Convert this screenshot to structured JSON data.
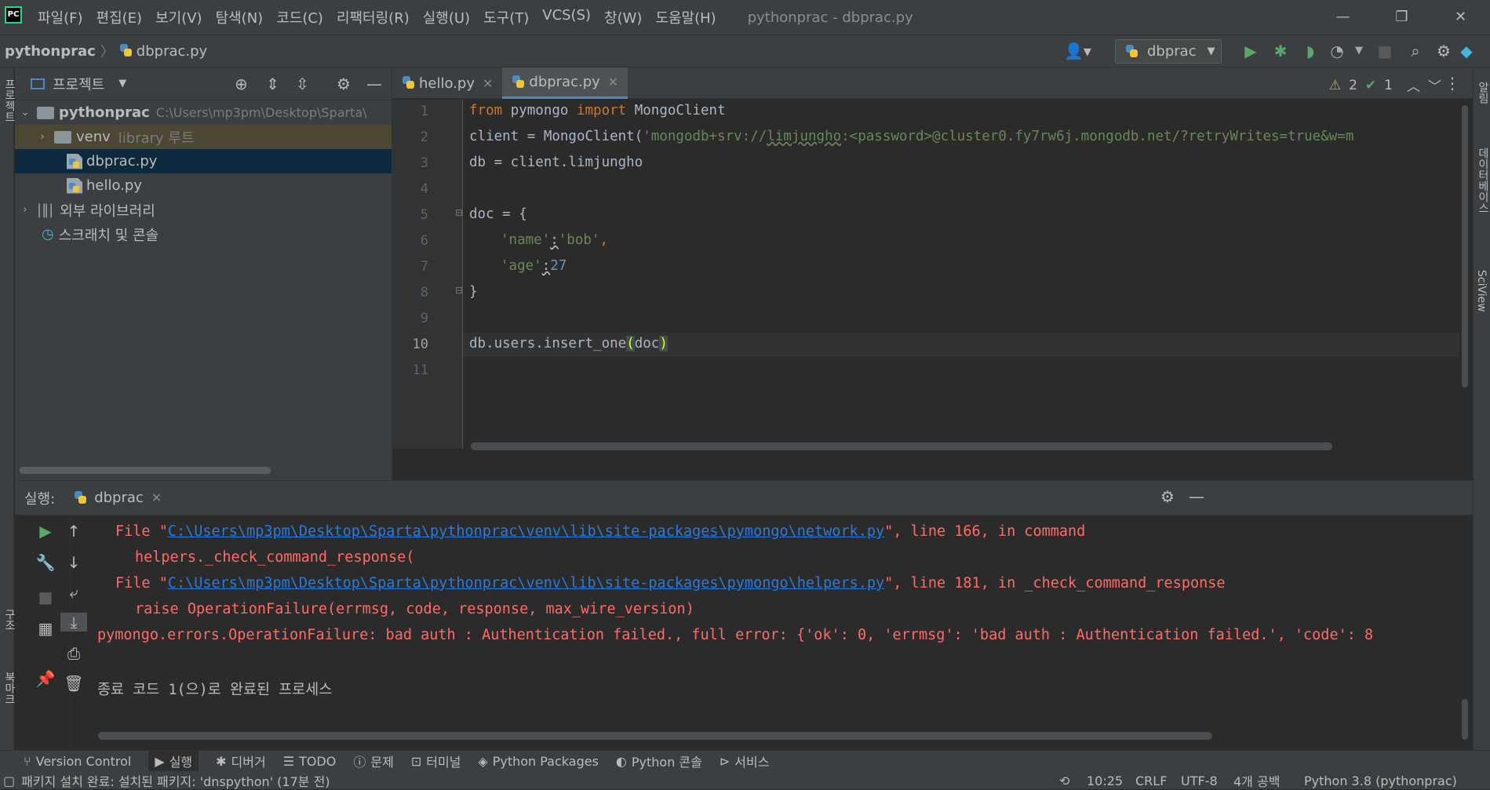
{
  "app": {
    "logo": "PC",
    "menu": [
      "파일(F)",
      "편집(E)",
      "보기(V)",
      "탐색(N)",
      "코드(C)",
      "리팩터링(R)",
      "실행(U)",
      "도구(T)",
      "VCS(S)",
      "창(W)",
      "도움말(H)"
    ],
    "window_title": "pythonprac - dbprac.py"
  },
  "nav": {
    "project": "pythonprac",
    "file": "dbprac.py",
    "run_config": "dbprac"
  },
  "project_panel": {
    "title": "프로젝트",
    "root": "pythonprac",
    "root_path": "C:\\Users\\mp3pm\\Desktop\\Sparta\\",
    "venv": "venv",
    "venv_note": "library 루트",
    "files": [
      "dbprac.py",
      "hello.py"
    ],
    "external": "외부 라이브러리",
    "scratches": "스크래치 및 콘솔"
  },
  "editor": {
    "tabs": [
      "hello.py",
      "dbprac.py"
    ],
    "warnings": "2",
    "checks": "1",
    "line_numbers": [
      "1",
      "2",
      "3",
      "4",
      "5",
      "6",
      "7",
      "8",
      "9",
      "10",
      "11"
    ],
    "l1": {
      "a": "from",
      "b": " pymongo ",
      "c": "import",
      "d": " MongoClient"
    },
    "l2": {
      "a": "client = MongoClient(",
      "b": "'mongodb+srv://",
      "c": "limjungho",
      "d": ":<password>@cluster0.fy7rw6j.mongodb.net/?retryWrites=true&w=m"
    },
    "l3": "db = client.limjungho",
    "l5": "doc = {",
    "l6": {
      "a": "'name'",
      "b": ":",
      "c": "'bob'",
      "d": ","
    },
    "l7": {
      "a": "'age'",
      "b": ":",
      "c": "27"
    },
    "l8": "}",
    "l10": {
      "a": "db.users.insert_one",
      "b": "(",
      "c": "doc",
      "d": ")"
    }
  },
  "run": {
    "label": "실행:",
    "tab": "dbprac",
    "o1": {
      "a": "File \"",
      "b": "C:\\Users\\mp3pm\\Desktop\\Sparta\\pythonprac\\venv\\lib\\site-packages\\pymongo\\network.py",
      "c": "\", line 166, in command"
    },
    "o2": "helpers._check_command_response(",
    "o3": {
      "a": "File \"",
      "b": "C:\\Users\\mp3pm\\Desktop\\Sparta\\pythonprac\\venv\\lib\\site-packages\\pymongo\\helpers.py",
      "c": "\", line 181, in _check_command_response"
    },
    "o4": "raise OperationFailure(errmsg, code, response, max_wire_version)",
    "o5": "pymongo.errors.OperationFailure: bad auth : Authentication failed., full error: {'ok': 0, 'errmsg': 'bad auth : Authentication failed.', 'code': 8",
    "o6": "종료 코드 1(으)로 완료된 프로세스"
  },
  "bottom_tabs": [
    "Version Control",
    "실행",
    "디버거",
    "TODO",
    "문제",
    "터미널",
    "Python Packages",
    "Python 콘솔",
    "서비스"
  ],
  "status": {
    "message": "패키지 설치 완료: 설치된 패키지: 'dnspython' (17분 전)",
    "time": "10:25",
    "eol": "CRLF",
    "enc": "UTF-8",
    "indent": "4개 공백",
    "interp": "Python 3.8 (pythonprac)"
  },
  "side_labels": {
    "left1": "프로젝트",
    "left2": "구조",
    "left3": "북마크",
    "right1": "알림",
    "right2": "데이터베이스",
    "right3": "SciView"
  }
}
